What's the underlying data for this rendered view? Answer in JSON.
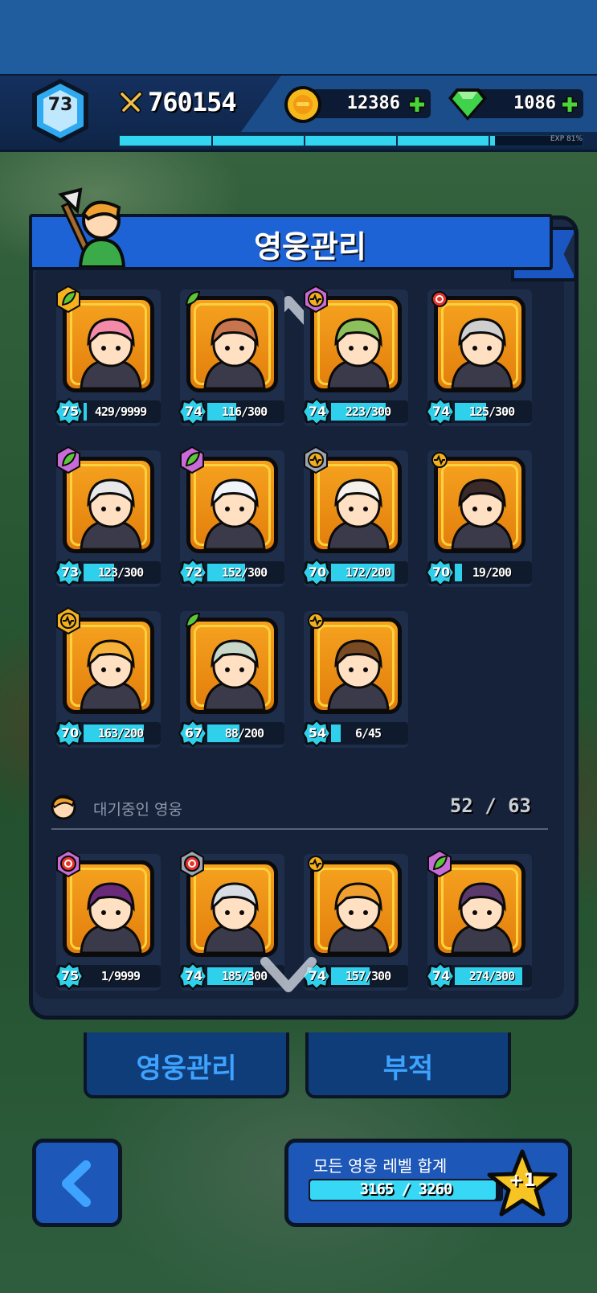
{
  "player": {
    "level": "73",
    "power": "760154",
    "gold": "12386",
    "gems": "1086",
    "exp_label": "EXP 81%",
    "exp_fraction": 0.81
  },
  "panel": {
    "title": "영웅관리"
  },
  "heroes": [
    {
      "level": "75",
      "progress": "429/9999",
      "fill": 0.04,
      "class": "green",
      "icon_bg": "#f4b21f",
      "rarity_ring": "gold"
    },
    {
      "level": "74",
      "progress": "116/300",
      "fill": 0.39,
      "class": "green",
      "icon_bg": "#1d2d4a",
      "rarity_ring": "none"
    },
    {
      "level": "74",
      "progress": "223/300",
      "fill": 0.74,
      "class": "heart",
      "icon_bg": "#1d2d4a",
      "rarity_ring": "rainbow"
    },
    {
      "level": "74",
      "progress": "125/300",
      "fill": 0.42,
      "class": "red",
      "icon_bg": "#1d2d4a",
      "rarity_ring": "none"
    },
    {
      "level": "73",
      "progress": "123/300",
      "fill": 0.41,
      "class": "green",
      "icon_bg": "#1d2d4a",
      "rarity_ring": "rainbow"
    },
    {
      "level": "72",
      "progress": "152/300",
      "fill": 0.51,
      "class": "green",
      "icon_bg": "#1d2d4a",
      "rarity_ring": "rainbow"
    },
    {
      "level": "70",
      "progress": "172/200",
      "fill": 0.86,
      "class": "heart",
      "icon_bg": "#9aa4b4",
      "rarity_ring": "silver"
    },
    {
      "level": "70",
      "progress": "19/200",
      "fill": 0.1,
      "class": "heart",
      "icon_bg": "#1d2d4a",
      "rarity_ring": "none"
    },
    {
      "level": "70",
      "progress": "163/200",
      "fill": 0.82,
      "class": "heart",
      "icon_bg": "#f4b21f",
      "rarity_ring": "gold"
    },
    {
      "level": "67",
      "progress": "88/200",
      "fill": 0.44,
      "class": "green",
      "icon_bg": "#1d2d4a",
      "rarity_ring": "none"
    },
    {
      "level": "54",
      "progress": "6/45",
      "fill": 0.13,
      "class": "heart",
      "icon_bg": "#1d2d4a",
      "rarity_ring": "none"
    }
  ],
  "standby": {
    "label": "대기중인 영웅",
    "count": "52 / 63",
    "heroes": [
      {
        "level": "75",
        "progress": "1/9999",
        "fill": 0.0,
        "class": "red",
        "rarity_ring": "rainbow"
      },
      {
        "level": "74",
        "progress": "185/300",
        "fill": 0.62,
        "class": "red",
        "rarity_ring": "silver"
      },
      {
        "level": "74",
        "progress": "157/300",
        "fill": 0.52,
        "class": "heart",
        "rarity_ring": "none"
      },
      {
        "level": "74",
        "progress": "274/300",
        "fill": 0.91,
        "class": "green",
        "rarity_ring": "rainbow"
      }
    ]
  },
  "tabs": {
    "heroes": "영웅관리",
    "talisman": "부적"
  },
  "total": {
    "label": "모든 영웅 레벨 합계",
    "value": "3165 / 3260",
    "fraction": 0.971,
    "bonus": "+1"
  },
  "colors": {
    "accent": "#1e63d6",
    "bar": "#2fd0ec",
    "portrait": "#f6a21f",
    "class_green": "#5cc63a",
    "class_red": "#e6342c",
    "class_heart": "#f2b01c"
  }
}
